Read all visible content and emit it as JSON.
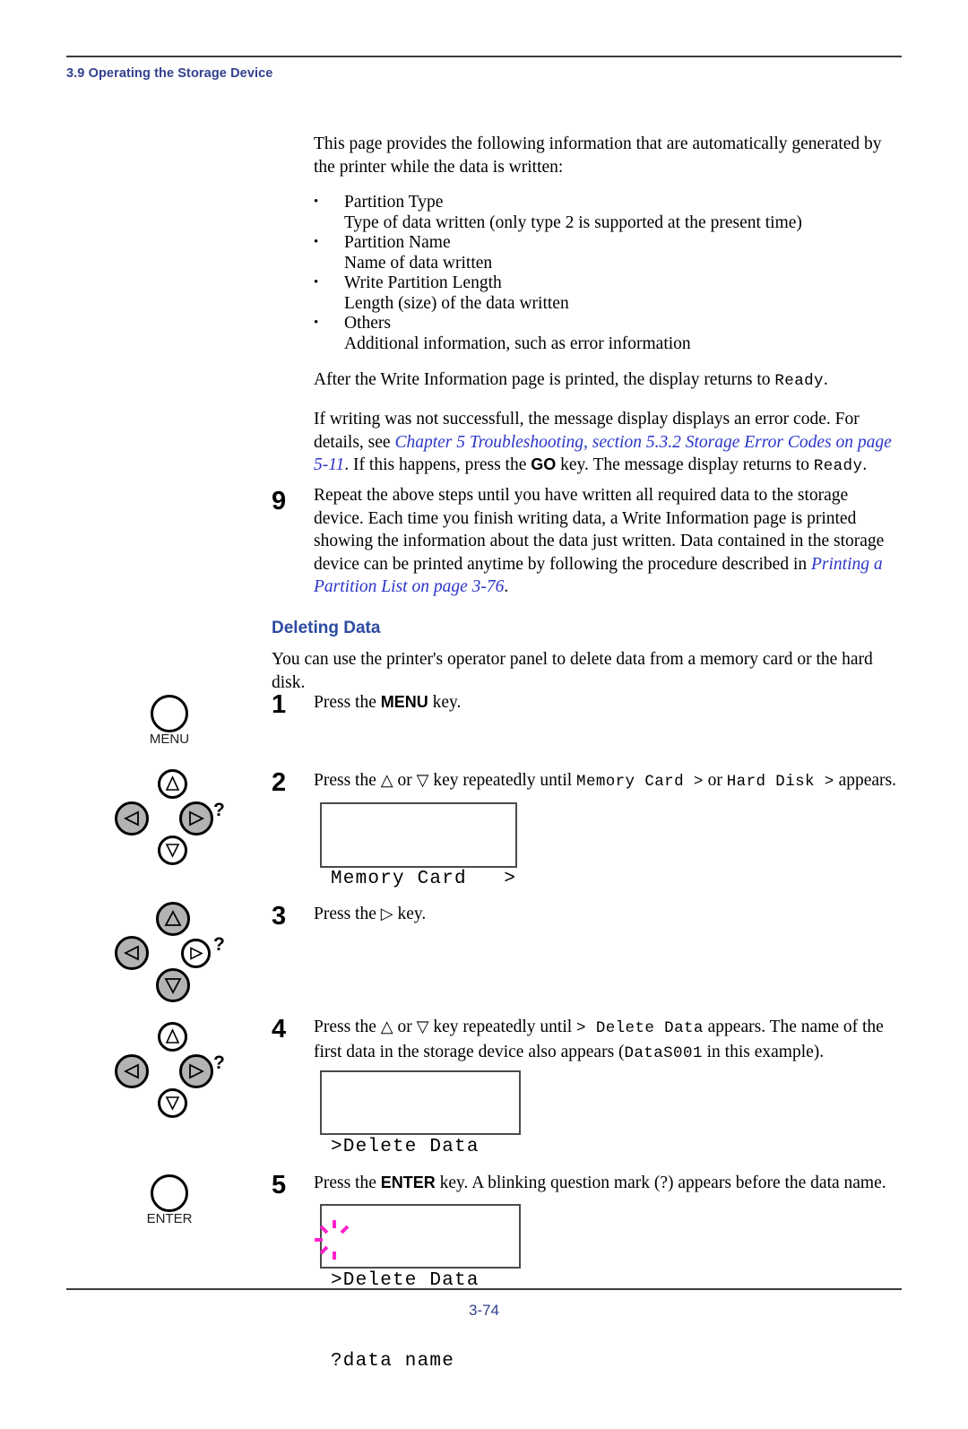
{
  "header": {
    "section": "3.9 Operating the Storage Device"
  },
  "footer": {
    "page_number": "3-74"
  },
  "intro": {
    "paragraph": "This page provides the following information that are automatically generated by the printer while the data is written:"
  },
  "bullets": [
    {
      "term": "Partition Type",
      "desc": "Type of data written (only type 2 is supported at the present time)"
    },
    {
      "term": "Partition Name",
      "desc": "Name of data written"
    },
    {
      "term": "Write Partition Length",
      "desc": "Length (size) of the data written"
    },
    {
      "term": "Others",
      "desc": "Additional information, such as error information"
    }
  ],
  "after_write": {
    "part1": "After the Write Information page is printed, the display returns to ",
    "code": "Ready",
    "part2": "."
  },
  "error_note": {
    "part1": "If writing was not successfull, the message display displays an error code. For details, see ",
    "link": "Chapter 5 Troubleshooting, section 5.3.2 Storage Error Codes on page 5-11",
    "part2": ". If  this happens, press the ",
    "key": "GO",
    "part3": " key. The message display returns to ",
    "code": "Ready",
    "part4": "."
  },
  "step9": {
    "number": "9",
    "part1": "Repeat the above steps until you have written all required data to the storage device. Each time you finish writing data, a Write Information page is printed showing the information about the data just written. Data contained in the storage device can be printed anytime by following the procedure described in ",
    "link": "Printing a Partition List on page 3-76",
    "part2": "."
  },
  "deleting": {
    "heading": "Deleting Data",
    "intro": "You can use the printer's operator panel to delete data from a memory card or the hard disk."
  },
  "steps": [
    {
      "number": "1",
      "text_parts": {
        "p1": "Press the ",
        "key": "MENU",
        "p2": " key."
      }
    },
    {
      "number": "2",
      "text_parts": {
        "p1": "Press the ",
        "up": "△",
        "p2": " or ",
        "down": "▽",
        "p3": " key repeatedly until ",
        "c1": "Memory Card >",
        "p4": " or ",
        "c2": "Hard Disk >",
        "p5": " appears."
      }
    },
    {
      "number": "3",
      "text_parts": {
        "p1": "Press the ",
        "right": "▷",
        "p2": " key."
      }
    },
    {
      "number": "4",
      "text_parts": {
        "p1": "Press the ",
        "up": "△",
        "p2": " or ",
        "down": "▽",
        "p3": " key repeatedly until ",
        "c1": "> Delete Data",
        "p4": " appears. The name of the first data in the storage device also appears (",
        "c2": "DataS001",
        "p5": " in this example)."
      }
    },
    {
      "number": "5",
      "text_parts": {
        "p1": "Press the ",
        "key": "ENTER",
        "p2": " key. A blinking question mark (?) appears before the data name."
      }
    }
  ],
  "displays": [
    {
      "line1": "Memory Card   >",
      "line2": ""
    },
    {
      "line1": ">Delete Data",
      "line2": " DataS001"
    },
    {
      "line1": ">Delete Data",
      "line2": "?data name"
    }
  ],
  "panel_keys": {
    "menu_label": "MENU",
    "enter_label": "ENTER",
    "help_mark": "?",
    "clusters": [
      {
        "up": "off",
        "down": "off",
        "left": "on",
        "right": "on"
      },
      {
        "up": "on",
        "down": "on",
        "left": "on",
        "right": "off"
      },
      {
        "up": "off",
        "down": "off",
        "left": "on",
        "right": "on"
      }
    ]
  },
  "colors": {
    "heading_blue": "#32408f",
    "link_blue": "#2b35c8",
    "blink_magenta": "#ff22cc",
    "key_on_gray": "#b3b3b3"
  }
}
